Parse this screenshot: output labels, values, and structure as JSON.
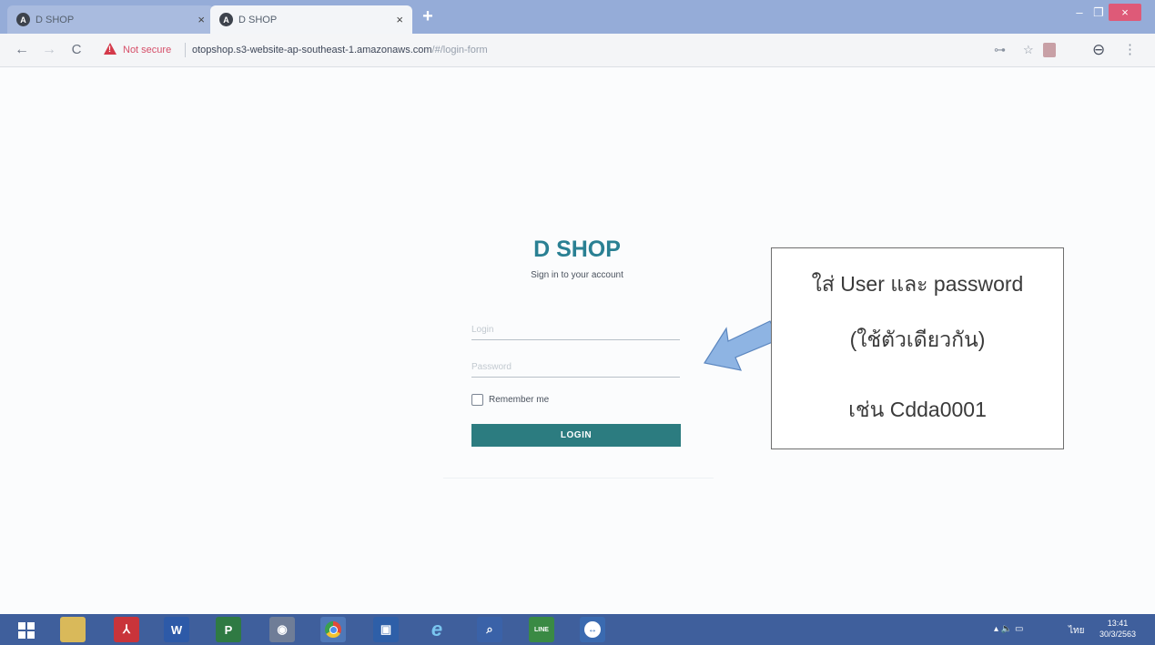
{
  "browser": {
    "tabs": [
      {
        "title": "D SHOP",
        "favicon": "A",
        "active": false
      },
      {
        "title": "D SHOP",
        "favicon": "A",
        "active": true
      }
    ],
    "new_tab_label": "+",
    "nav": {
      "back": "←",
      "forward": "→",
      "reload": "C"
    },
    "security_label": "Not secure",
    "url_host": "otopshop.s3-website-ap-southeast-1.amazonaws.com",
    "url_path": "/#/login-form",
    "window_controls": {
      "minimize": "–",
      "maximize": "❐",
      "close": "×"
    },
    "toolbar_icons": {
      "key": "⊶",
      "star": "☆",
      "account": "⊖",
      "menu": "⋮"
    }
  },
  "login": {
    "brand": "D SHOP",
    "subtitle": "Sign in to your account",
    "login_placeholder": "Login",
    "password_placeholder": "Password",
    "login_value": "",
    "password_value": "",
    "remember_label": "Remember me",
    "remember_checked": false,
    "button_label": "LOGIN",
    "accent_color": "#2a8093",
    "button_color": "#2c7c80"
  },
  "annotation": {
    "line1": "ใส่ User และ password",
    "line2": "(ใช้ตัวเดียวกัน)",
    "line3": "เช่น Cdda0001",
    "arrow_color": "#8eb4e3"
  },
  "taskbar": {
    "apps": [
      "file-explorer",
      "acrobat",
      "word",
      "project",
      "camera",
      "chrome",
      "store",
      "internet-explorer",
      "search",
      "line",
      "teamviewer"
    ],
    "app_labels": {
      "word": "W",
      "project": "P",
      "ie": "e",
      "line": "LINE",
      "teamviewer": "↔"
    },
    "tray_icons": "▴  🔈  ▭",
    "language": "ไทย",
    "time": "13:41",
    "date": "30/3/2563"
  }
}
